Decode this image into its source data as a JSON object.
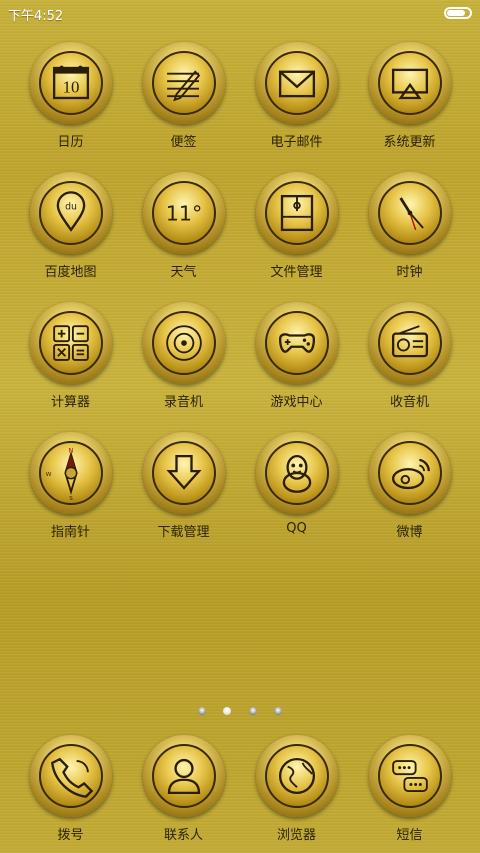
{
  "status_bar": {
    "time": "下午4:52",
    "battery_level": 0.85
  },
  "apps": [
    {
      "label": "日历",
      "icon": "calendar-icon",
      "day": "10"
    },
    {
      "label": "便签",
      "icon": "note-pencil-icon"
    },
    {
      "label": "电子邮件",
      "icon": "mail-icon"
    },
    {
      "label": "系统更新",
      "icon": "system-update-icon"
    },
    {
      "label": "百度地图",
      "icon": "map-pin-icon",
      "badge": "du"
    },
    {
      "label": "天气",
      "icon": "weather-icon",
      "temp": "11°"
    },
    {
      "label": "文件管理",
      "icon": "folder-icon"
    },
    {
      "label": "时钟",
      "icon": "clock-icon"
    },
    {
      "label": "计算器",
      "icon": "calculator-icon"
    },
    {
      "label": "录音机",
      "icon": "recorder-icon"
    },
    {
      "label": "游戏中心",
      "icon": "gamepad-icon"
    },
    {
      "label": "收音机",
      "icon": "radio-icon"
    },
    {
      "label": "指南针",
      "icon": "compass-icon",
      "north": "N",
      "west": "W",
      "south": "S"
    },
    {
      "label": "下载管理",
      "icon": "download-icon"
    },
    {
      "label": "QQ",
      "icon": "qq-penguin-icon"
    },
    {
      "label": "微博",
      "icon": "weibo-icon"
    }
  ],
  "page_indicator": {
    "count": 4,
    "active_index": 1
  },
  "dock": [
    {
      "label": "拨号",
      "icon": "phone-icon"
    },
    {
      "label": "联系人",
      "icon": "contact-icon"
    },
    {
      "label": "浏览器",
      "icon": "browser-globe-icon"
    },
    {
      "label": "短信",
      "icon": "message-icon"
    }
  ],
  "colors": {
    "gold_light": "#fff4b0",
    "gold_mid": "#e6c447",
    "gold_dark": "#7a5a0a",
    "outline": "#3b2b05",
    "label_text": "#2b2407"
  }
}
